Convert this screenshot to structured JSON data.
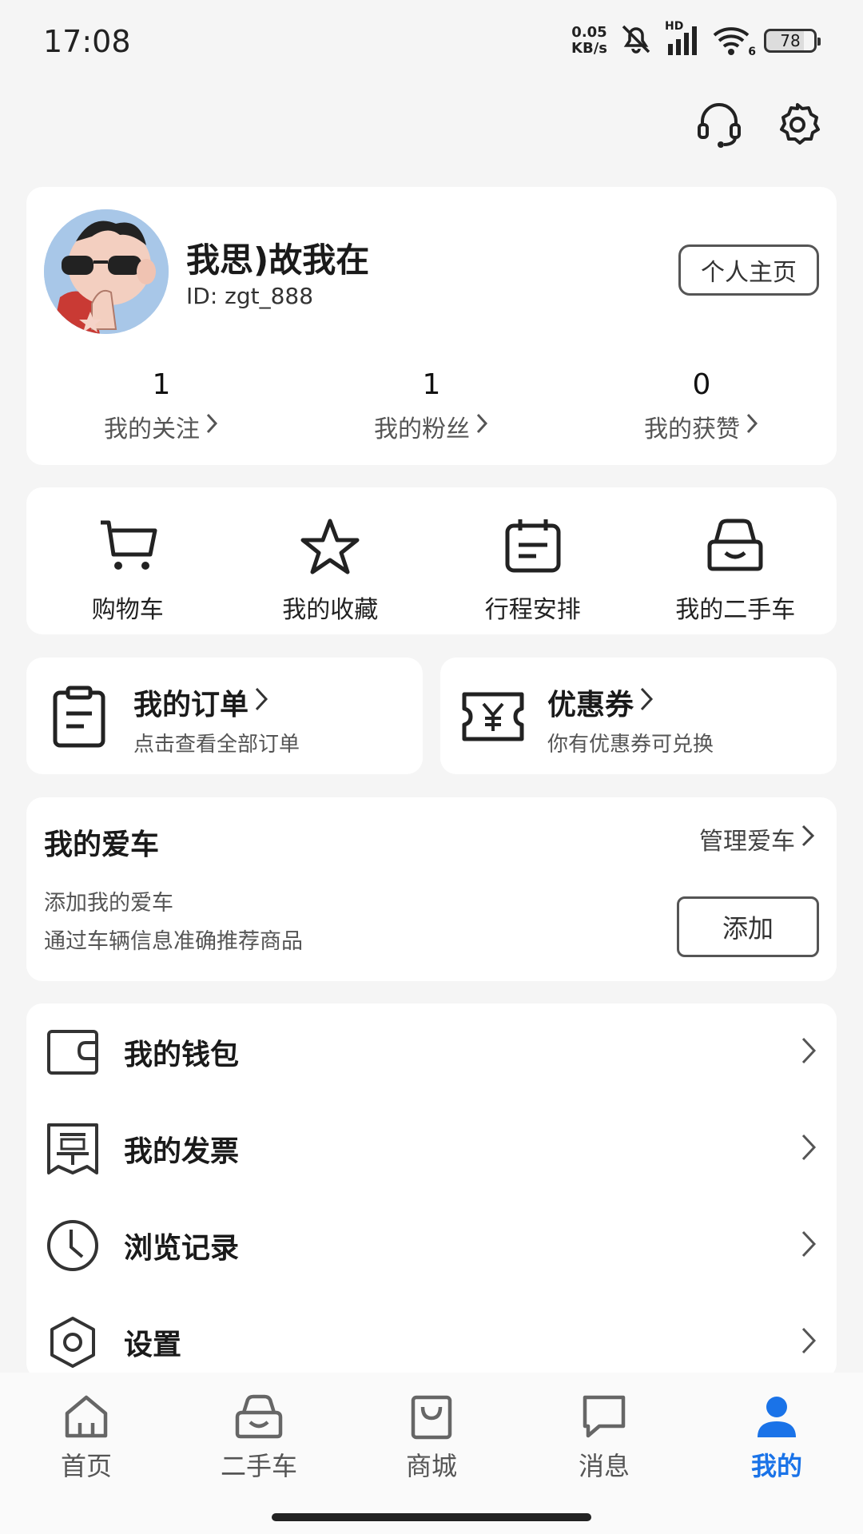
{
  "status_bar": {
    "time": "17:08",
    "net_speed_value": "0.05",
    "net_speed_unit": "KB/s",
    "signal_label": "HD",
    "wifi_label": "6",
    "battery": "78"
  },
  "header": {
    "icons": [
      "headset-icon",
      "gear-icon"
    ]
  },
  "profile": {
    "nickname": "我思)故我在",
    "user_id": "ID: zgt_888",
    "homepage_button": "个人主页",
    "stats": [
      {
        "value": "1",
        "label": "我的关注"
      },
      {
        "value": "1",
        "label": "我的粉丝"
      },
      {
        "value": "0",
        "label": "我的获赞"
      }
    ]
  },
  "quick_actions": [
    {
      "label": "购物车",
      "icon": "cart-icon"
    },
    {
      "label": "我的收藏",
      "icon": "star-icon"
    },
    {
      "label": "行程安排",
      "icon": "calendar-icon"
    },
    {
      "label": "我的二手车",
      "icon": "car-icon"
    }
  ],
  "orders": {
    "title": "我的订单",
    "subtitle": "点击查看全部订单"
  },
  "coupons": {
    "title": "优惠券",
    "subtitle": "你有优惠券可兑换"
  },
  "my_car": {
    "title": "我的爱车",
    "manage_link": "管理爱车",
    "line1": "添加我的爱车",
    "line2": "通过车辆信息准确推荐商品",
    "add_button": "添加"
  },
  "menu_list": [
    {
      "label": "我的钱包",
      "icon": "wallet-icon"
    },
    {
      "label": "我的发票",
      "icon": "invoice-icon"
    },
    {
      "label": "浏览记录",
      "icon": "clock-icon"
    },
    {
      "label": "设置",
      "icon": "gear-icon"
    }
  ],
  "bottom_nav": [
    {
      "label": "首页",
      "icon": "home-icon",
      "active": false
    },
    {
      "label": "二手车",
      "icon": "car-icon",
      "active": false
    },
    {
      "label": "商城",
      "icon": "bag-icon",
      "active": false
    },
    {
      "label": "消息",
      "icon": "message-icon",
      "active": false
    },
    {
      "label": "我的",
      "icon": "person-icon",
      "active": true
    }
  ],
  "colors": {
    "accent": "#1a73e8",
    "background": "#f5f5f5",
    "card": "#ffffff"
  }
}
